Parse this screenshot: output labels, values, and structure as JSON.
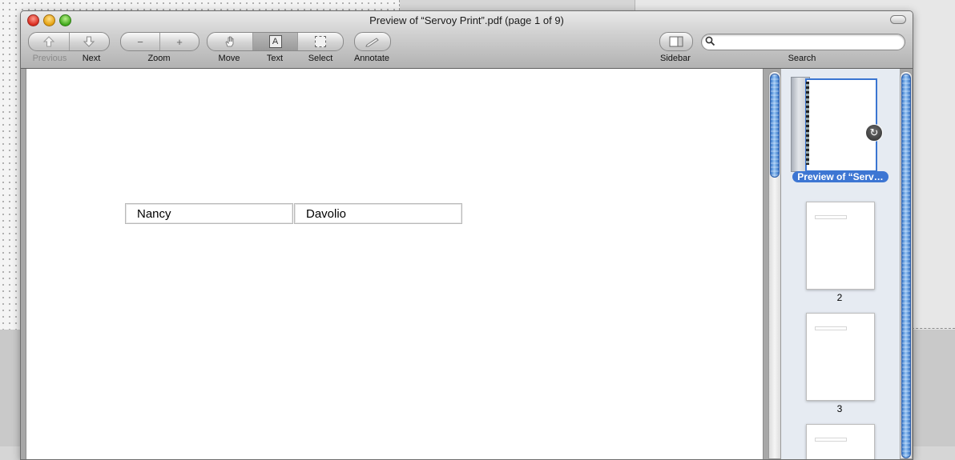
{
  "window": {
    "title": "Preview of “Servoy Print”.pdf (page 1 of 9)"
  },
  "toolbar": {
    "previous_label": "Previous",
    "next_label": "Next",
    "zoom_label": "Zoom",
    "zoom_out_glyph": "−",
    "zoom_in_glyph": "+",
    "move_label": "Move",
    "text_label": "Text",
    "text_glyph": "A",
    "select_label": "Select",
    "annotate_label": "Annotate",
    "sidebar_label": "Sidebar",
    "search_label": "Search",
    "active_tool": "Text"
  },
  "search": {
    "value": "",
    "placeholder": ""
  },
  "document": {
    "cells": [
      "Nancy",
      "Davolio"
    ]
  },
  "sidebar": {
    "selected_page_label": "Preview of “Serv…",
    "thumbnails": [
      {
        "number": "2"
      },
      {
        "number": "3"
      }
    ],
    "rotate_glyph": "↻"
  },
  "colors": {
    "selection_blue": "#3d76d3",
    "sidebar_bg": "#e6ebf2"
  }
}
